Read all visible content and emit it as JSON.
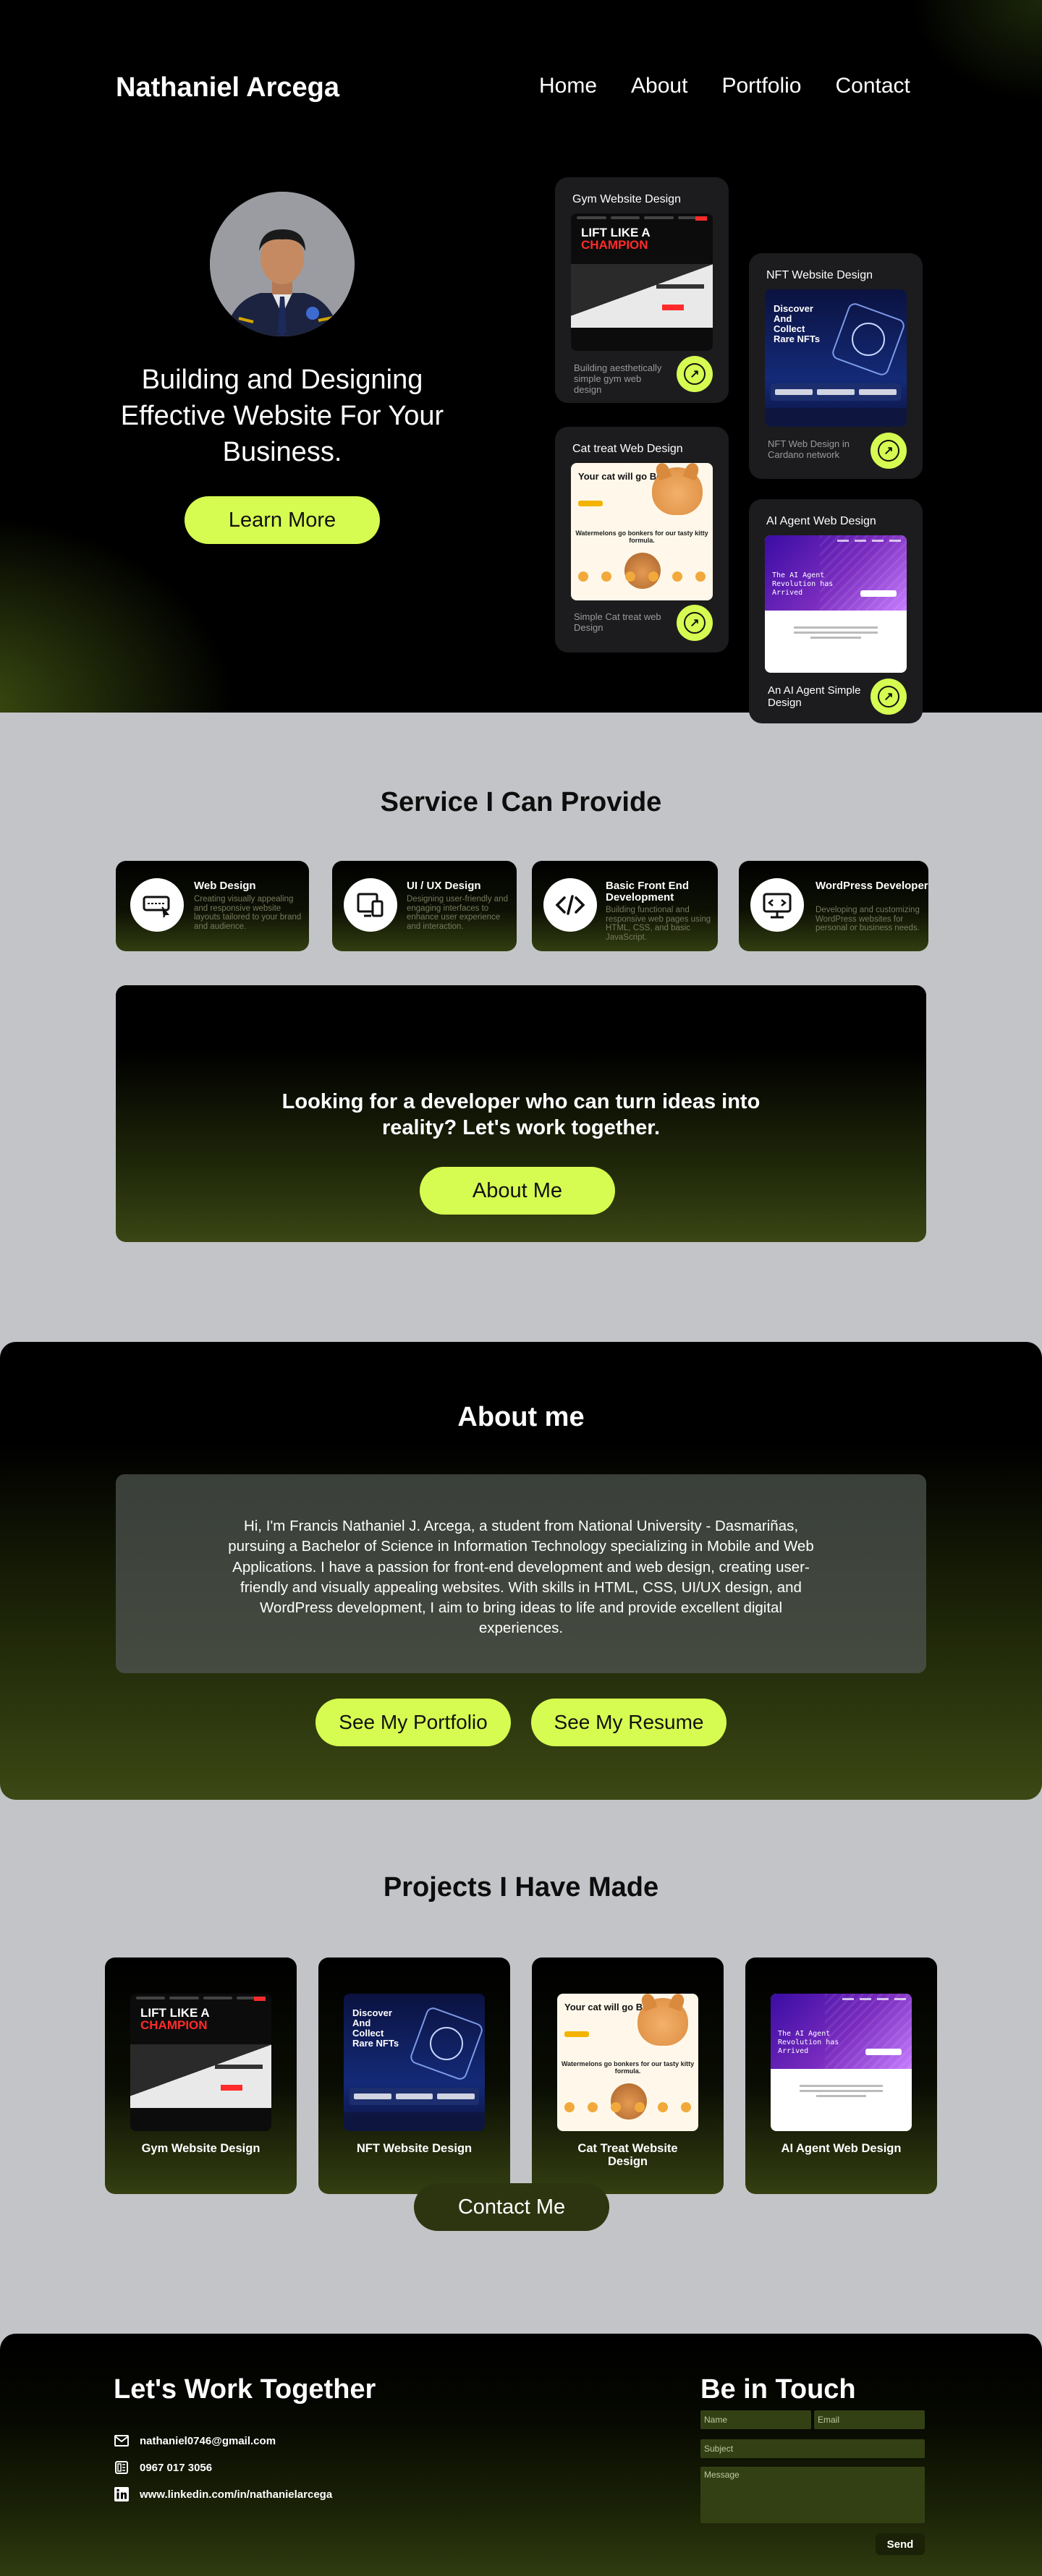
{
  "header": {
    "brand": "Nathaniel Arcega",
    "nav": [
      "Home",
      "About",
      "Portfolio",
      "Contact"
    ]
  },
  "hero": {
    "headline": "Building and Designing Effective Website For Your Business.",
    "cta": "Learn More"
  },
  "hero_cards": [
    {
      "title": "Gym Website Design",
      "desc": "Building aesthetically simple gym web design"
    },
    {
      "title": "Cat treat Web Design",
      "desc": "Simple Cat treat web Design"
    },
    {
      "title": "NFT Website Design",
      "desc": "NFT Web Design in Cardano network"
    },
    {
      "title": "AI Agent Web Design",
      "desc": "An AI Agent Simple Design"
    }
  ],
  "thumbs": {
    "gym_line1": "LIFT LIKE A",
    "gym_line2": "CHAMPION",
    "nft": "Discover And Collect Rare NFTs",
    "cat_title": "Your cat will go Bonkers",
    "cat_mid": "Watermelons go bonkers for our tasty kitty formula.",
    "ai": "The AI Agent Revolution has Arrived"
  },
  "services": {
    "title": "Service I Can Provide",
    "items": [
      {
        "title": "Web Design",
        "desc": "Creating visually appealing and responsive website layouts tailored to your brand and audience.",
        "icon": "web-design-icon"
      },
      {
        "title": "UI / UX Design",
        "desc": "Designing user-friendly and engaging interfaces to enhance user experience and interaction.",
        "icon": "ui-ux-icon"
      },
      {
        "title": "Basic Front End Development",
        "desc": "Building functional and responsive web pages using HTML, CSS, and basic JavaScript.",
        "icon": "code-icon"
      },
      {
        "title": "WordPress Developer",
        "desc": "Developing and customizing WordPress websites for personal or business needs.",
        "icon": "wordpress-monitor-icon"
      }
    ],
    "cta_text": "Looking for a developer who can turn ideas into reality? Let's work together.",
    "cta_button": "About Me"
  },
  "about": {
    "title": "About me",
    "text": "Hi, I'm Francis Nathaniel J. Arcega, a student from National University - Dasmariñas, pursuing a Bachelor of Science in Information Technology specializing in Mobile and Web Applications. I have a passion for front-end development and web design, creating user-friendly and visually appealing websites. With skills in HTML, CSS, UI/UX design, and WordPress development, I aim to bring ideas to life and provide excellent digital experiences.",
    "buttons": [
      "See My Portfolio",
      "See My Resume"
    ]
  },
  "projects": {
    "title": "Projects I Have Made",
    "items": [
      "Gym Website Design",
      "NFT Website Design",
      "Cat Treat Website Design",
      "AI Agent Web Design"
    ],
    "contact_button": "Contact Me"
  },
  "footer": {
    "title": "Let's Work Together",
    "email": "nathaniel0746@gmail.com",
    "phone": "0967 017 3056",
    "linkedin": "www.linkedin.com/in/nathanielarcega",
    "form_title": "Be in Touch",
    "placeholders": {
      "name": "Name",
      "email": "Email",
      "subject": "Subject",
      "message": "Message"
    },
    "send": "Send"
  },
  "colors": {
    "accent": "#d6fc51",
    "dark": "#000000",
    "olive": "#3a4614",
    "page_bg": "#c3c4c7"
  }
}
